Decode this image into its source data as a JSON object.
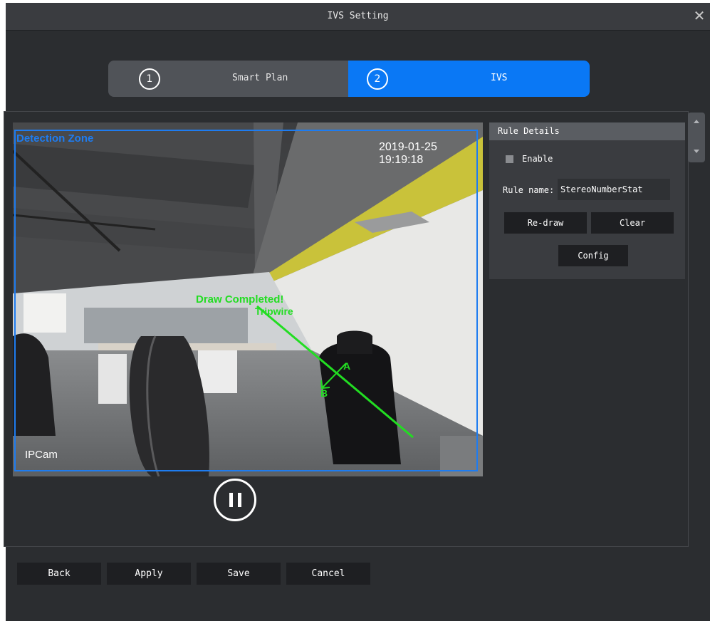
{
  "dialog": {
    "title": "IVS Setting"
  },
  "steps": [
    {
      "number": "1",
      "label": "Smart Plan",
      "active": false
    },
    {
      "number": "2",
      "label": "IVS",
      "active": true
    }
  ],
  "video": {
    "zone_label": "Detection Zone",
    "timestamp": "2019-01-25 19:19:18",
    "draw_status": "Draw Completed!",
    "line_label": "Tripwire",
    "point_a": "A",
    "point_b": "B",
    "camera_name": "IPCam"
  },
  "rule_details": {
    "header": "Rule Details",
    "enable_label": "Enable",
    "enable_checked": false,
    "rule_name_label": "Rule name:",
    "rule_name_value": "StereoNumberStat",
    "redraw_label": "Re-draw",
    "clear_label": "Clear",
    "config_label": "Config"
  },
  "footer": {
    "back": "Back",
    "apply": "Apply",
    "save": "Save",
    "cancel": "Cancel"
  },
  "colors": {
    "accent": "#0a78f5",
    "zone": "#1e7cf0",
    "tripwire": "#22dd22"
  }
}
